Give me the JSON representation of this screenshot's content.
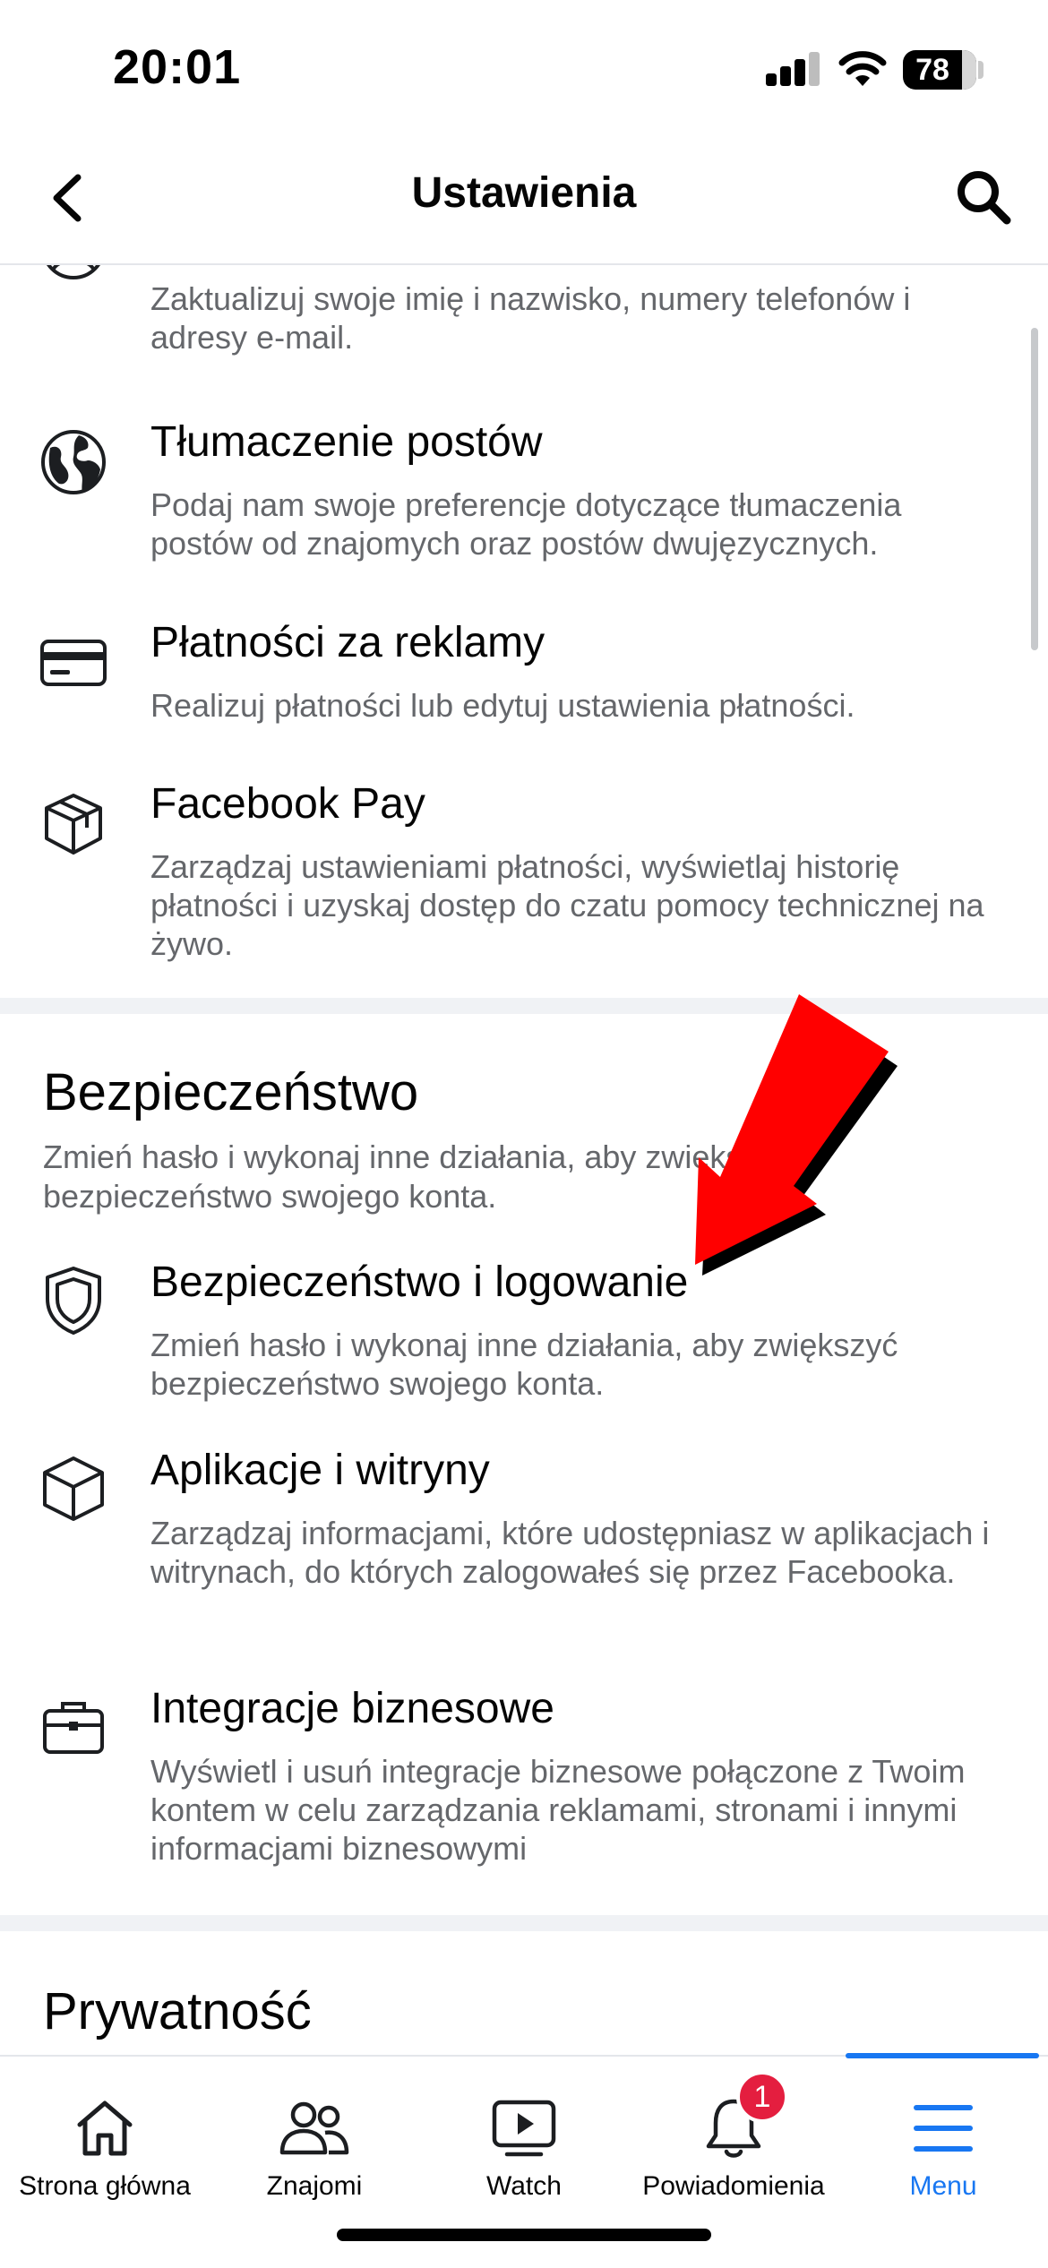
{
  "status_bar": {
    "time": "20:01",
    "battery": "78"
  },
  "header": {
    "title": "Ustawienia",
    "back_icon": "chevron-left-icon",
    "search_icon": "search-icon"
  },
  "account_items": [
    {
      "icon": "person-circle-icon",
      "title": "",
      "desc": "Zaktualizuj swoje imię i nazwisko, numery telefonów i adresy e-mail."
    },
    {
      "icon": "globe-icon",
      "title": "Tłumaczenie postów",
      "desc": "Podaj nam swoje preferencje dotyczące tłumaczenia postów od znajomych oraz postów dwujęzycznych."
    },
    {
      "icon": "credit-card-icon",
      "title": "Płatności za reklamy",
      "desc": "Realizuj płatności lub edytuj ustawienia płatności."
    },
    {
      "icon": "box-icon",
      "title": "Facebook Pay",
      "desc": "Zarządzaj ustawieniami płatności, wyświetlaj historię płatności i uzyskaj dostęp do czatu pomocy technicznej na żywo."
    }
  ],
  "security_section": {
    "title": "Bezpieczeństwo",
    "desc": "Zmień hasło i wykonaj inne działania, aby zwiększyć bezpieczeństwo swojego konta.",
    "items": [
      {
        "icon": "shield-icon",
        "title": "Bezpieczeństwo i logowanie",
        "desc": "Zmień hasło i wykonaj inne działania, aby zwiększyć bezpieczeństwo swojego konta."
      },
      {
        "icon": "cube-icon",
        "title": "Aplikacje i witryny",
        "desc": "Zarządzaj informacjami, które udostępniasz w aplikacjach i witrynach, do których zalogowałeś się przez Facebooka."
      },
      {
        "icon": "briefcase-icon",
        "title": "Integracje biznesowe",
        "desc": "Wyświetl i usuń integracje biznesowe połączone z Twoim kontem w celu zarządzania reklamami, stronami i innymi informacjami biznesowymi"
      }
    ]
  },
  "privacy_section": {
    "title": "Prywatność"
  },
  "tab_bar": {
    "tabs": [
      {
        "label": "Strona główna",
        "icon": "home-icon"
      },
      {
        "label": "Znajomi",
        "icon": "friends-icon"
      },
      {
        "label": "Watch",
        "icon": "watch-icon"
      },
      {
        "label": "Powiadomienia",
        "icon": "bell-icon",
        "badge": "1"
      },
      {
        "label": "Menu",
        "icon": "menu-icon",
        "active": true
      }
    ]
  },
  "colors": {
    "accent": "#1877f2",
    "badge": "#e41e3f",
    "annotation_arrow": "#ff0000"
  }
}
